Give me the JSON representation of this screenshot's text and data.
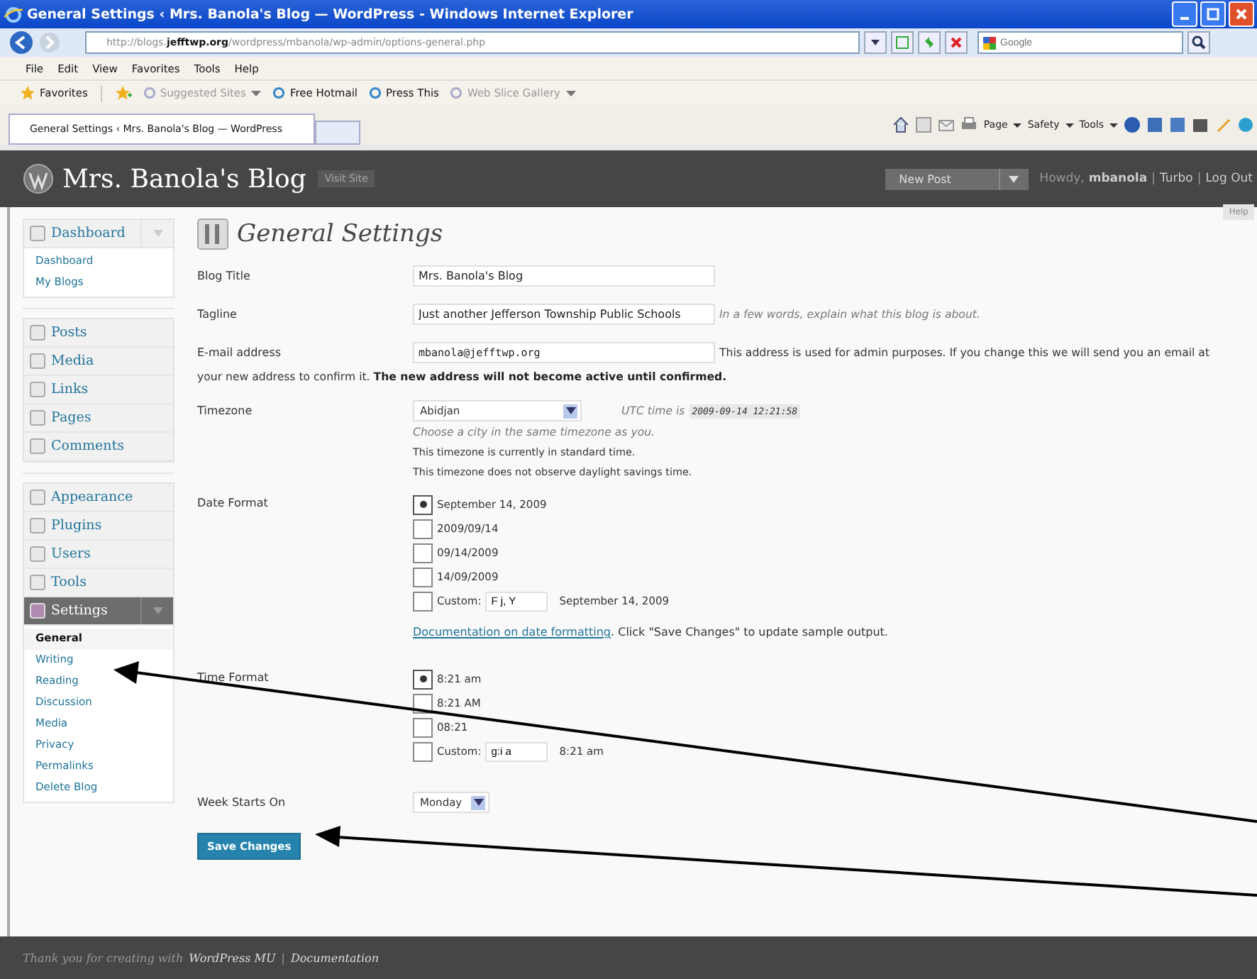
{
  "browser": {
    "title": "General Settings ‹ Mrs. Banola's Blog — WordPress - Windows Internet Explorer",
    "address": "http://blogs.**jefftwp.org**/wordpress/mbanola/wp-admin/options-general.php",
    "search": {
      "placeholder": "Google"
    },
    "menu": [
      "File",
      "Edit",
      "View",
      "Favorites",
      "Tools",
      "Help"
    ],
    "favorites_label": "Favorites",
    "favorites": [
      {
        "label": "Suggested Sites",
        "disabled": true,
        "dropdown": true
      },
      {
        "label": "Free Hotmail",
        "disabled": false,
        "dropdown": false
      },
      {
        "label": "Press This",
        "disabled": false,
        "dropdown": false
      },
      {
        "label": "Web Slice Gallery",
        "disabled": true,
        "dropdown": true
      }
    ],
    "tab": "General Settings ‹ Mrs. Banola's Blog — WordPress",
    "commands": [
      "Page",
      "Safety",
      "Tools"
    ]
  },
  "header": {
    "site_title": "Mrs. Banola's Blog",
    "visit_site": "Visit Site",
    "new_post": "New Post",
    "greeting": "Howdy,",
    "user": "mbanola",
    "links": [
      "Turbo",
      "Log Out"
    ],
    "separator": "|",
    "help": "Help"
  },
  "sidebar": {
    "groups": [
      [
        {
          "label": "Dashboard",
          "selected": false,
          "expanded": true,
          "children": [
            {
              "label": "Dashboard",
              "selected": false
            },
            {
              "label": "My Blogs",
              "selected": false
            }
          ]
        }
      ],
      [
        {
          "label": "Posts",
          "selected": false,
          "expanded": false
        },
        {
          "label": "Media",
          "selected": false,
          "expanded": false
        },
        {
          "label": "Links",
          "selected": false,
          "expanded": false
        },
        {
          "label": "Pages",
          "selected": false,
          "expanded": false
        },
        {
          "label": "Comments",
          "selected": false,
          "expanded": false
        }
      ],
      [
        {
          "label": "Appearance",
          "selected": false,
          "expanded": false
        },
        {
          "label": "Plugins",
          "selected": false,
          "expanded": false
        },
        {
          "label": "Users",
          "selected": false,
          "expanded": false
        },
        {
          "label": "Tools",
          "selected": false,
          "expanded": false
        },
        {
          "label": "Settings",
          "selected": true,
          "expanded": true,
          "children": [
            {
              "label": "General",
              "selected": true
            },
            {
              "label": "Writing",
              "selected": false
            },
            {
              "label": "Reading",
              "selected": false
            },
            {
              "label": "Discussion",
              "selected": false
            },
            {
              "label": "Media",
              "selected": false
            },
            {
              "label": "Privacy",
              "selected": false
            },
            {
              "label": "Permalinks",
              "selected": false
            },
            {
              "label": "Delete Blog",
              "selected": false
            }
          ]
        }
      ]
    ]
  },
  "page_title": "General Settings",
  "form": [
    {
      "kind": "text",
      "label": "Blog Title",
      "value": "Mrs. Banola's Blog"
    },
    {
      "kind": "text",
      "label": "Tagline",
      "value": "Just another Jefferson Township Public Schools",
      "hint": "In a few words, explain what this blog is about."
    },
    {
      "kind": "email",
      "label": "E-mail address",
      "value": "mbanola@jefftwp.org",
      "description": [
        "This address is used for admin purposes. If you change this we will send you an email at",
        "your new address to confirm it. **The new address will not become active until confirmed.**"
      ]
    },
    {
      "kind": "timezone",
      "label": "Timezone",
      "value": "Abidjan",
      "utc_label": "UTC time is",
      "utc_time": "2009-09-14 12:21:58",
      "hint": "Choose a city in the same timezone as you.",
      "notes": [
        "This timezone is currently in standard time.",
        "This timezone does not observe daylight savings time."
      ]
    },
    {
      "kind": "radios",
      "label": "Date Format",
      "options": [
        {
          "label": "September 14, 2009",
          "selected": true
        },
        {
          "label": "2009/09/14",
          "selected": false
        },
        {
          "label": "09/14/2009",
          "selected": false
        },
        {
          "label": "14/09/2009",
          "selected": false
        },
        {
          "label": "Custom:",
          "selected": false,
          "value": "F j, Y",
          "sample": "September 14, 2009"
        }
      ],
      "link": "Documentation on date formatting",
      "after_link": ". Click \"Save Changes\" to update sample output."
    },
    {
      "kind": "radios",
      "label": "Time Format",
      "options": [
        {
          "label": "8:21 am",
          "selected": true
        },
        {
          "label": "8:21 AM",
          "selected": false
        },
        {
          "label": "08:21",
          "selected": false
        },
        {
          "label": "Custom:",
          "selected": false,
          "value": "g:i a",
          "sample": "8:21 am"
        }
      ]
    },
    {
      "kind": "select",
      "label": "Week Starts On",
      "value": "Monday"
    }
  ],
  "save_button": "Save Changes",
  "footer": {
    "text": "Thank you for creating with",
    "links": [
      "WordPress MU",
      "Documentation"
    ],
    "separator": "|"
  }
}
